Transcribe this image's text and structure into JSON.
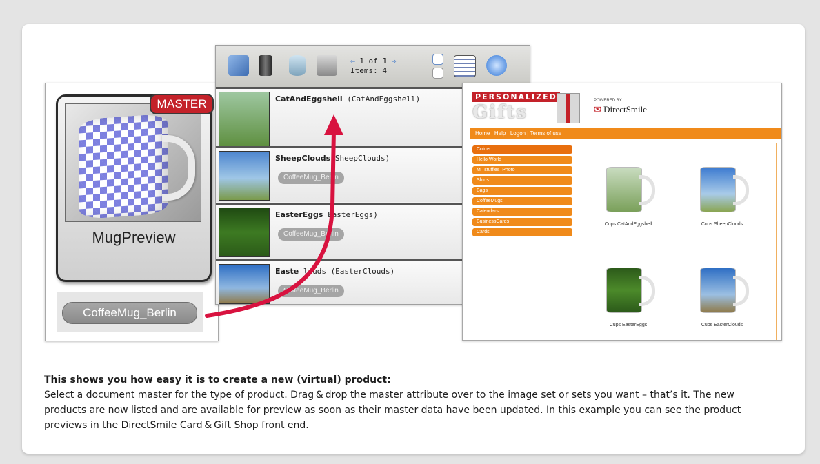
{
  "master_panel": {
    "badge": "MASTER",
    "document_name": "MugPreview",
    "attribute": "CoffeeMug_Berlin"
  },
  "image_sets": {
    "pager": {
      "page_text": "1 of 1",
      "items_text": "Items: 4"
    },
    "sets": [
      {
        "name": "CatAndEggshell",
        "id": "(CatAndEggshell)",
        "attribute": ""
      },
      {
        "name": "SheepClouds",
        "id": "SheepClouds)",
        "attribute": "CoffeeMug_Berlin"
      },
      {
        "name": "EasterEggs",
        "id": "EasterEggs)",
        "attribute": "CoffeeMug_Berlin"
      },
      {
        "name": "Easte",
        "id": "louds (EasterClouds)",
        "attribute": "CoffeeMug_Berlin"
      }
    ]
  },
  "shop": {
    "logo_top": "PERSONALIZED",
    "logo_main": "Gifts",
    "powered_by": "POWERED BY",
    "brand": "DirectSmile",
    "nav": "Home | Help | Logon | Terms of use",
    "menu": [
      "Colors",
      "Hello World",
      "Mi_stuffies_Photo",
      "Shirts",
      "Bags",
      "CoffeeMugs",
      "Calendars",
      "BusinessCards",
      "Cards"
    ],
    "products": [
      "Cups CatAndEggshell",
      "Cups SheepClouds",
      "Cups EasterEggs",
      "Cups EasterClouds"
    ]
  },
  "caption": {
    "heading": "This shows you how easy it is to create a new (virtual) product:",
    "body": "Select a document master for the type of product. Drag & drop the master attribute over to the image set or sets you want – that’s it. The new products are now listed and are available for preview as soon as their master data have been updated. In this example you can see the product previews in the DirectSmile Card & Gift Shop front end."
  },
  "colors": {
    "accent_orange": "#f08a1a",
    "badge_red": "#c4222a",
    "arrow_red": "#d8123f",
    "checker_blue": "#7d80e0"
  }
}
